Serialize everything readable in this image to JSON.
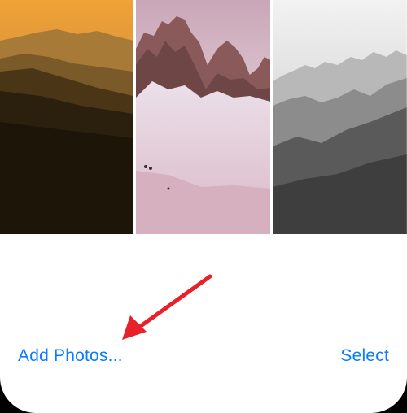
{
  "photos": [
    {
      "name": "sunset-mountain-photo"
    },
    {
      "name": "snowy-peaks-photo"
    },
    {
      "name": "monochrome-mountain-photo"
    }
  ],
  "actions": {
    "add_photos_label": "Add Photos...",
    "select_label": "Select"
  },
  "colors": {
    "accent": "#0a7cff",
    "annotation_arrow": "#e8202a"
  }
}
